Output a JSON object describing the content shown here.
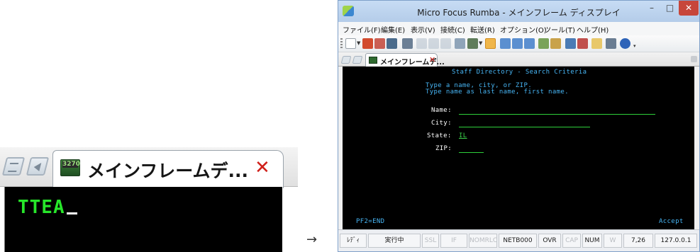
{
  "zoom": {
    "tab_label": "メインフレームデ...",
    "tab_icon_text": "3270",
    "close_glyph": "✕",
    "terminal_text": "TTEA"
  },
  "arrow": "→",
  "window": {
    "title": "Micro Focus Rumba - メインフレーム ディスプレイ",
    "buttons": {
      "minimize": "–",
      "maximize": "□",
      "close": "✕"
    },
    "menu": [
      "ファイル(F)",
      "編集(E)",
      "表示(V)",
      "接続(C)",
      "転送(R)",
      "オプション(O)",
      "ツール(T)",
      "ヘルプ(H)"
    ],
    "toolbar_icons": [
      "new-session-icon",
      "connect-icon",
      "disconnect-icon",
      "save-icon",
      "settings-icon",
      "cut-icon",
      "copy-icon",
      "paste-icon",
      "undo-icon",
      "screen-icon",
      "active-macro-icon",
      "send-icon",
      "receive-icon",
      "transfer-icon",
      "record-icon",
      "tools-icon",
      "play-icon",
      "stop-icon",
      "notepad-icon",
      "keyboard-icon",
      "help-icon"
    ],
    "doc_tab": {
      "label": "メインフレームデ...",
      "close": "✕"
    }
  },
  "terminal": {
    "title": "Staff Directory - Search Criteria",
    "instructions": [
      "Type a name, city, or ZIP.",
      "Type name as last name, first name."
    ],
    "fields": [
      {
        "label": "Name:",
        "value": ""
      },
      {
        "label": "City:",
        "value": ""
      },
      {
        "label": "State:",
        "value": "IL"
      },
      {
        "label": "ZIP:",
        "value": ""
      }
    ],
    "pf_key": "PF2=END",
    "accept": "Accept"
  },
  "status": {
    "items": [
      {
        "text": "ﾚﾃﾞｨ",
        "active": true
      },
      {
        "text": "実行中",
        "active": true
      },
      {
        "text": "SSL",
        "active": false
      },
      {
        "text": "IF",
        "active": false
      },
      {
        "text": "NOMRLC",
        "active": false
      },
      {
        "text": "NETB000",
        "active": true
      },
      {
        "text": "OVR",
        "active": true
      },
      {
        "text": "CAP",
        "active": false
      },
      {
        "text": "NUM",
        "active": true
      },
      {
        "text": "W",
        "active": false
      },
      {
        "text": "7,26",
        "active": true
      },
      {
        "text": "127.0.0.1",
        "active": true
      }
    ]
  },
  "colors": {
    "terminal_bg": "#000000",
    "terminal_text": "#47b5f4",
    "field_label": "#ffffff",
    "field_input": "#3bd24a",
    "close_red": "#d0201a",
    "title_bar": "#b4cce9"
  }
}
